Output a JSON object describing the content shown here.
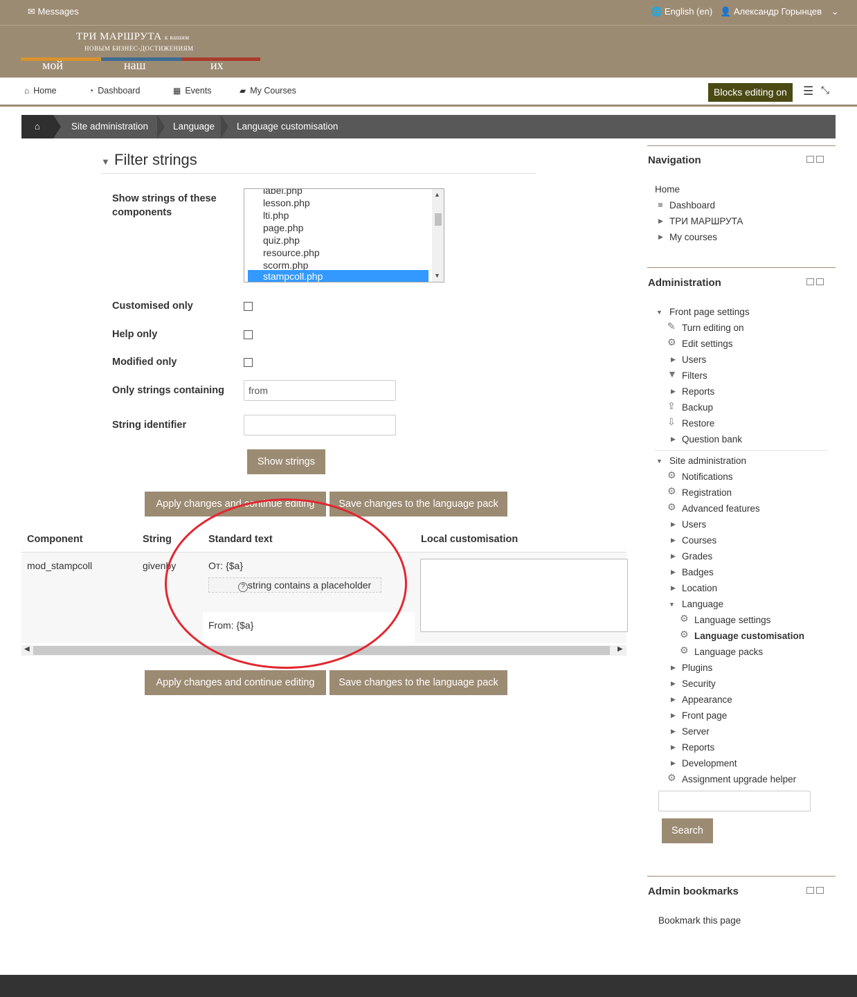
{
  "topbar": {
    "messages": "Messages",
    "language": "English (en)",
    "user": "Александр Горынцев"
  },
  "logo": {
    "line1": "ТРИ МАРШРУТА",
    "line1_small": "к вашим",
    "line2": "НОВЫМ БИЗНЕС-ДОСТИЖЕНИЯМ",
    "word1": "мой",
    "word2": "наш",
    "word3": "их",
    "colors": [
      "#d9932b",
      "#3d6c96",
      "#a93a2b"
    ]
  },
  "nav": {
    "home": "Home",
    "dashboard": "Dashboard",
    "events": "Events",
    "my_courses": "My Courses",
    "blocks_editing": "Blocks editing on"
  },
  "breadcrumb": {
    "items": [
      "Site administration",
      "Language",
      "Language customisation"
    ]
  },
  "filter": {
    "title": "Filter strings",
    "components_label": "Show strings of these components",
    "components": [
      "label.php",
      "lesson.php",
      "lti.php",
      "page.php",
      "quiz.php",
      "resource.php",
      "scorm.php",
      "stampcoll.php"
    ],
    "selected": "stampcoll.php",
    "customised_only": "Customised only",
    "help_only": "Help only",
    "modified_only": "Modified only",
    "only_containing": "Only strings containing",
    "only_containing_value": "from",
    "string_identifier": "String identifier",
    "string_identifier_value": "",
    "show_button": "Show strings"
  },
  "actions": {
    "apply": "Apply changes and continue editing",
    "save": "Save changes to the language pack"
  },
  "table": {
    "headers": [
      "Component",
      "String",
      "Standard text",
      "Local customisation"
    ],
    "row": {
      "component": "mod_stampcoll",
      "string": "givenby",
      "standard": "От: {$a}",
      "placeholder_note": "string contains a placeholder",
      "master": "From: {$a}"
    }
  },
  "navigation_block": {
    "title": "Navigation",
    "home": "Home",
    "items": [
      "Dashboard",
      "ТРИ МАРШРУТА",
      "My courses"
    ]
  },
  "admin_block": {
    "title": "Administration",
    "front_page_settings": "Front page settings",
    "front_items": [
      "Turn editing on",
      "Edit settings",
      "Users",
      "Filters",
      "Reports",
      "Backup",
      "Restore",
      "Question bank"
    ],
    "site_administration": "Site administration",
    "site_items": [
      "Notifications",
      "Registration",
      "Advanced features",
      "Users",
      "Courses",
      "Grades",
      "Badges",
      "Location",
      "Language"
    ],
    "language_items": [
      "Language settings",
      "Language customisation",
      "Language packs"
    ],
    "site_items_after": [
      "Plugins",
      "Security",
      "Appearance",
      "Front page",
      "Server",
      "Reports",
      "Development",
      "Assignment upgrade helper"
    ],
    "search_button": "Search"
  },
  "bookmarks_block": {
    "title": "Admin bookmarks",
    "bookmark": "Bookmark this page"
  }
}
